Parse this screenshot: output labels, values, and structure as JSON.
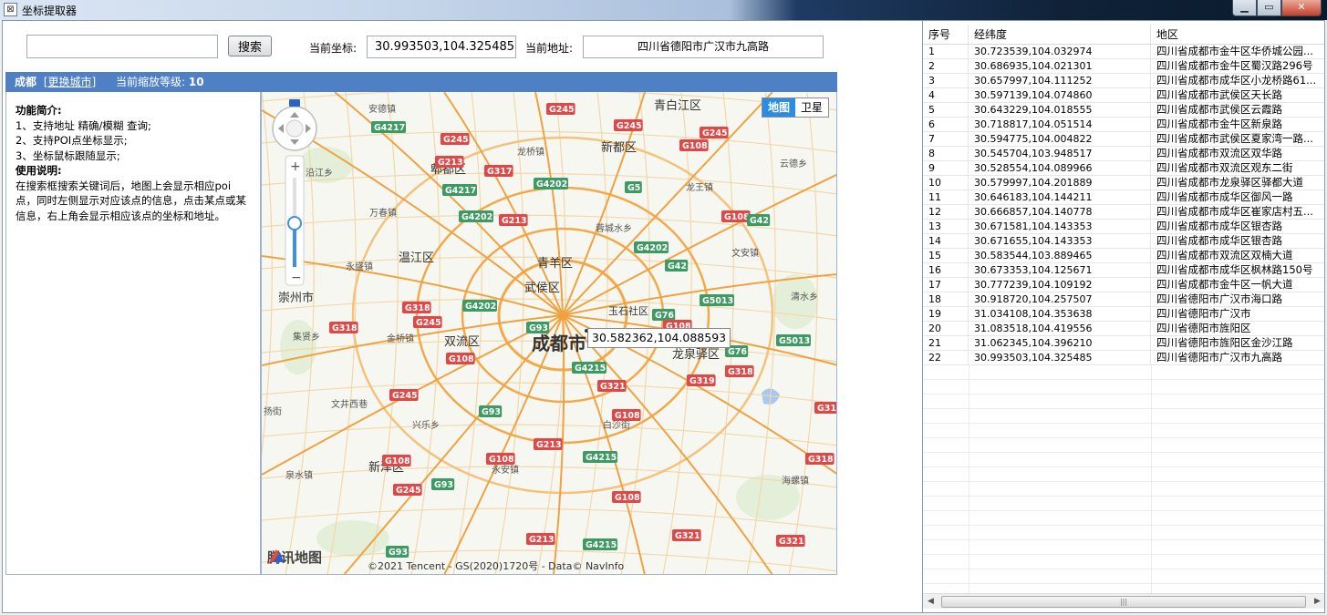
{
  "window": {
    "title": "坐标提取器"
  },
  "toolbar": {
    "search_value": "",
    "search_button": "搜索",
    "coord_label": "当前坐标:",
    "coord_value": "30.993503,104.325485",
    "addr_label": "当前地址:",
    "addr_value": "四川省德阳市广汉市九高路"
  },
  "citybar": {
    "city": "成都",
    "change_city": "[更换城市]",
    "zoom_label": "当前缩放等级:",
    "zoom_value": "10"
  },
  "info": {
    "features_title": "功能简介:",
    "features": [
      "1、支持地址 精确/模糊 查询;",
      "2、支持POI点坐标显示;",
      "3、坐标鼠标跟随显示;"
    ],
    "usage_title": "使用说明:",
    "usage": "在搜索框搜索关键词后，地图上会显示相应poi点，同时左侧显示对应该点的信息，点击某点或某信息，右上角会显示相应该点的坐标和地址。"
  },
  "map": {
    "type_map": "地图",
    "type_satellite": "卫星",
    "cursor_coord": "30.582362,104.088593",
    "brand": "腾讯地图",
    "copyright": "©2021 Tencent - GS(2020)1720号 - Data© NavInfo",
    "districts": [
      {
        "name": "成都市",
        "size": "big"
      },
      {
        "name": "青羊区"
      },
      {
        "name": "武侯区"
      },
      {
        "name": "双流区"
      },
      {
        "name": "温江区"
      },
      {
        "name": "郫都区"
      },
      {
        "name": "新都区"
      },
      {
        "name": "青白江区"
      },
      {
        "name": "龙泉驿区"
      },
      {
        "name": "新津区"
      },
      {
        "name": "崇州市"
      },
      {
        "name": "玉石社区"
      }
    ],
    "towns": [
      "安德镇",
      "沿江乡",
      "万春镇",
      "永盛镇",
      "集贤乡",
      "金桥镇",
      "文井西巷",
      "兴乐乡",
      "泉水镇",
      "永安镇",
      "白沙街",
      "蓉城水乡",
      "龙桥镇",
      "龙王镇",
      "文安镇",
      "清水乡",
      "海螺镇",
      "云德乡",
      "扬街"
    ],
    "roads": [
      "G245",
      "G4217",
      "G213",
      "G317",
      "G4202",
      "G5",
      "G108",
      "G42",
      "G318",
      "G93",
      "G76",
      "G5013",
      "G4215",
      "G321",
      "G319"
    ]
  },
  "table": {
    "headers": [
      "序号",
      "经纬度",
      "地区"
    ],
    "rows": [
      [
        "1",
        "30.723539,104.032974",
        "四川省成都市金牛区华侨城公园..."
      ],
      [
        "2",
        "30.686935,104.021301",
        "四川省成都市金牛区蜀汉路296号"
      ],
      [
        "3",
        "30.657997,104.111252",
        "四川省成都市成华区小龙桥路61..."
      ],
      [
        "4",
        "30.597139,104.074860",
        "四川省成都市武侯区天长路"
      ],
      [
        "5",
        "30.643229,104.018555",
        "四川省成都市武侯区云霞路"
      ],
      [
        "6",
        "30.718817,104.051514",
        "四川省成都市金牛区新泉路"
      ],
      [
        "7",
        "30.594775,104.004822",
        "四川省成都市武侯区夏家湾一路..."
      ],
      [
        "8",
        "30.545704,103.948517",
        "四川省成都市双流区双华路"
      ],
      [
        "9",
        "30.528554,104.089966",
        "四川省成都市双流区观东二街"
      ],
      [
        "10",
        "30.579997,104.201889",
        "四川省成都市龙泉驿区驿都大道"
      ],
      [
        "11",
        "30.646183,104.144211",
        "四川省成都市成华区御风一路"
      ],
      [
        "12",
        "30.666857,104.140778",
        "四川省成都市成华区崔家店村五..."
      ],
      [
        "13",
        "30.671581,104.143353",
        "四川省成都市成华区银杏路"
      ],
      [
        "14",
        "30.671655,104.143353",
        "四川省成都市成华区银杏路"
      ],
      [
        "15",
        "30.583544,103.889465",
        "四川省成都市双流区双楠大道"
      ],
      [
        "16",
        "30.673353,104.125671",
        "四川省成都市成华区枫林路150号"
      ],
      [
        "17",
        "30.777239,104.109192",
        "四川省成都市金牛区一帆大道"
      ],
      [
        "18",
        "30.918720,104.257507",
        "四川省德阳市广汉市海口路"
      ],
      [
        "19",
        "31.034108,104.353638",
        "四川省德阳市广汉市"
      ],
      [
        "20",
        "31.083518,104.419556",
        "四川省德阳市旌阳区"
      ],
      [
        "21",
        "31.062345,104.396210",
        "四川省德阳市旌阳区金沙江路"
      ],
      [
        "22",
        "30.993503,104.325485",
        "四川省德阳市广汉市九高路"
      ]
    ]
  }
}
